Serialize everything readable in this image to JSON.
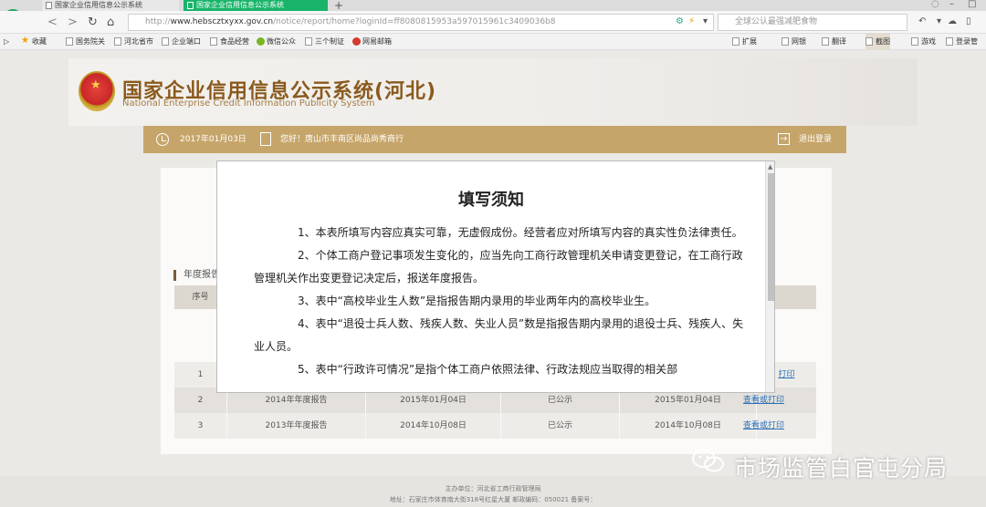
{
  "browser": {
    "tabs": [
      {
        "label": "国家企业信用信息公示系统"
      },
      {
        "label": "国家企业信用信息公示系统"
      }
    ],
    "url_scheme": "http://",
    "url_host": "www.hebscztxyxx.gov.cn",
    "url_path": "/notice/report/home?loginId=ff8080815953a597015961c3409036b8",
    "search_placeholder": "全球公认最强减肥食物",
    "bookmarks": [
      "收藏",
      "国务院关",
      "河北省市",
      "企业端口",
      "食品经营",
      "微信公众",
      "三个制证",
      "网易邮箱"
    ],
    "bookmarks_right": [
      "扩展",
      "网银",
      "翻译",
      "截图",
      "游戏",
      "登录管"
    ]
  },
  "site": {
    "title": "国家企业信用信息公示系统(河北)",
    "subtitle": "National Enterprise Credit Information Publicity System",
    "date": "2017年01月03日",
    "greeting": "您好！唐山市丰南区尚品尚秀商行",
    "logout": "退出登录"
  },
  "report_section": {
    "heading": "年度报告",
    "columns": [
      "序号",
      "",
      "",
      "",
      "",
      ""
    ],
    "rows": [
      {
        "index": "1",
        "name": "",
        "submit_date": "",
        "status": "",
        "publish_date": "",
        "action": "打印"
      },
      {
        "index": "2",
        "name": "2014年年度报告",
        "submit_date": "2015年01月04日",
        "status": "已公示",
        "publish_date": "2015年01月04日",
        "action": "查看或打印"
      },
      {
        "index": "3",
        "name": "2013年年度报告",
        "submit_date": "2014年10月08日",
        "status": "已公示",
        "publish_date": "2014年10月08日",
        "action": "查看或打印"
      }
    ]
  },
  "footer": {
    "line1": "主办单位：河北省工商行政管理局",
    "line2": "地址：石家庄市体育南大街318号红星大厦 邮政编码：050021 备案号："
  },
  "modal": {
    "title": "填写须知",
    "paragraphs": [
      "1、本表所填写内容应真实可靠，无虚假成份。经营者应对所填写内容的真实性负法律责任。",
      "2、个体工商户登记事项发生变化的，应当先向工商行政管理机关申请变更登记，在工商行政管理机关作出变更登记决定后，报送年度报告。",
      "3、表中“高校毕业生人数”是指报告期内录用的毕业两年内的高校毕业生。",
      "4、表中“退役士兵人数、残疾人数、失业人员”数是指报告期内录用的退役士兵、残疾人、失业人员。",
      "5、表中“行政许可情况”是指个体工商户依照法律、行政法规应当取得的相关部"
    ]
  },
  "watermark": "市场监管白官屯分局",
  "colors": {
    "accent_gold": "#c6a56a",
    "title_brown": "#8a5a1d",
    "tab_active": "#19b46a",
    "link": "#2b6fb7"
  }
}
